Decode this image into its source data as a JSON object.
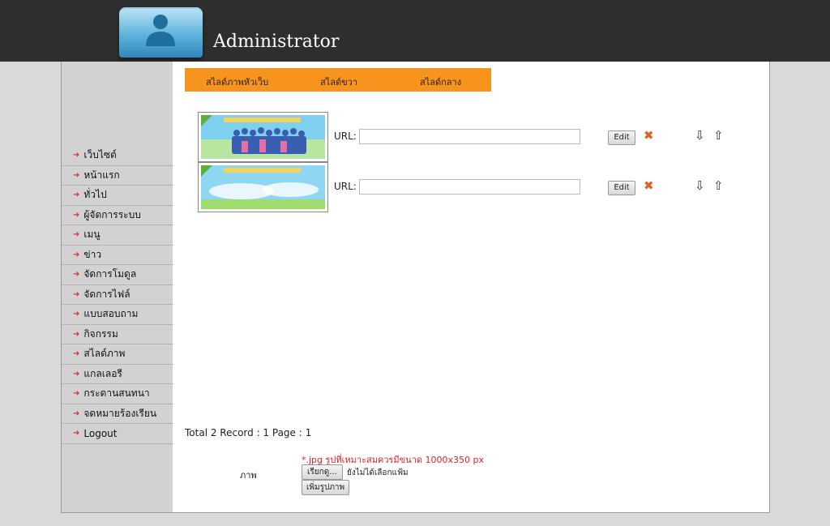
{
  "header": {
    "title": "Administrator",
    "logo_icon": "user-avatar-icon"
  },
  "colors": {
    "topbar": "#2e2e2e",
    "tab_bar": "#f7941d",
    "menu_arrow": "#dd3333",
    "delete_icon": "#e0601d",
    "note_text": "#dd2222"
  },
  "tabs": [
    {
      "label": "สไลด์ภาพหัวเว็บ"
    },
    {
      "label": "สไลด์ขวา"
    },
    {
      "label": "สไลด์กลาง"
    }
  ],
  "sidebar": {
    "items": [
      {
        "label": "เว็บไซต์"
      },
      {
        "label": "หน้าแรก"
      },
      {
        "label": "ทั่วไป"
      },
      {
        "label": "ผู้จัดการระบบ"
      },
      {
        "label": "เมนู"
      },
      {
        "label": "ข่าว"
      },
      {
        "label": "จัดการโมดูล"
      },
      {
        "label": "จัดการไฟล์"
      },
      {
        "label": "แบบสอบถาม"
      },
      {
        "label": "กิจกรรม"
      },
      {
        "label": "สไลด์ภาพ"
      },
      {
        "label": "แกลเลอรี"
      },
      {
        "label": "กระดานสนทนา"
      },
      {
        "label": "จดหมายร้องเรียน"
      },
      {
        "label": "Logout"
      }
    ]
  },
  "slides": [
    {
      "url_label": "URL:",
      "url_value": "",
      "edit_label": "Edit"
    },
    {
      "url_label": "URL:",
      "url_value": "",
      "edit_label": "Edit"
    }
  ],
  "footer": {
    "total": "Total 2 Record : 1 Page : 1",
    "note": "*.jpg รูปที่เหมาะสมควรมีขนาด 1000x350 px",
    "image_label": "ภาพ",
    "browse_label": "เรียกดู...",
    "no_file": "ยังไม่ได้เลือกแฟ้ม",
    "add_label": "เพิ่มรูปภาพ"
  }
}
